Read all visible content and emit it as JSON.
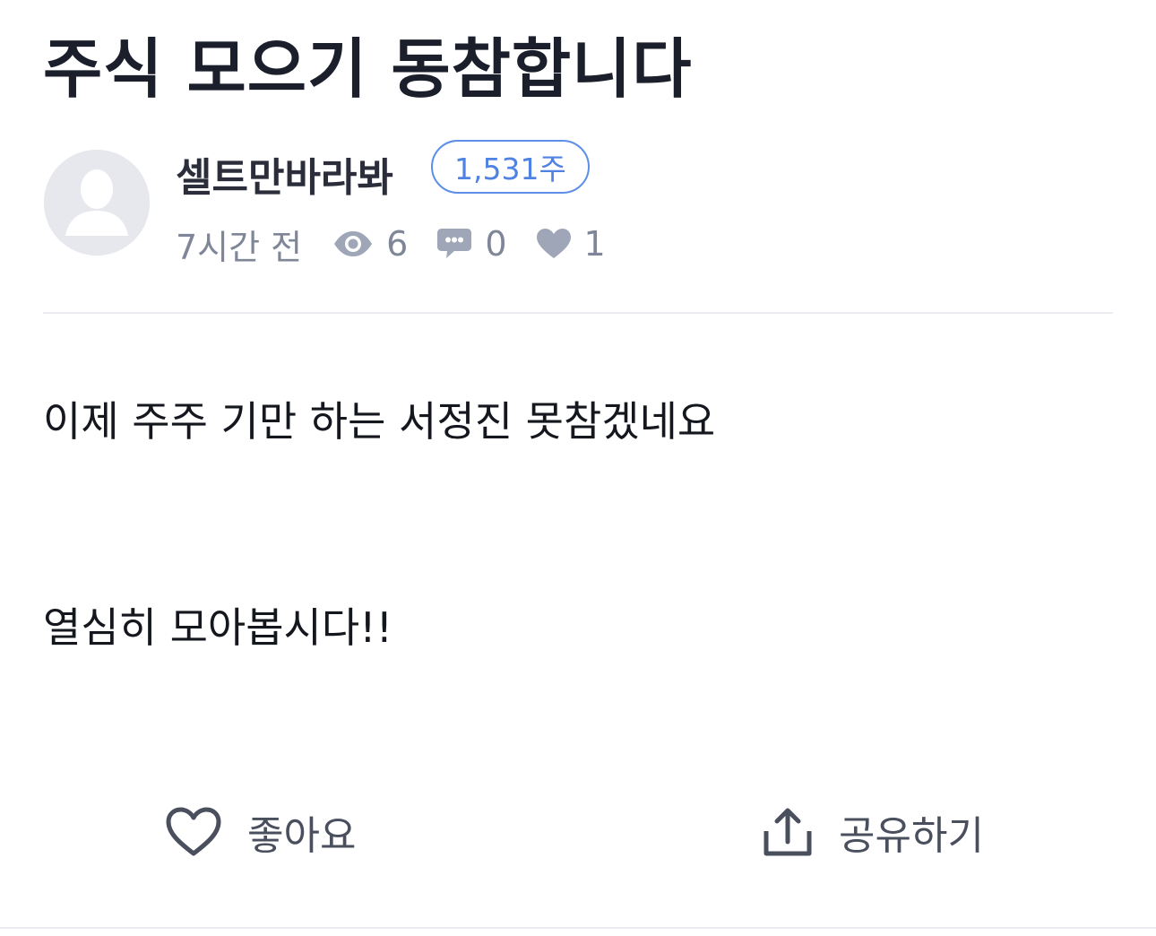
{
  "post": {
    "title": "주식 모으기 동참합니다",
    "author": {
      "name": "셀트만바라봐",
      "shares_badge": "1,531주",
      "avatar_icon": "user-silhouette-icon"
    },
    "meta": {
      "time_ago": "7시간 전",
      "views": "6",
      "comments": "0",
      "likes": "1"
    },
    "body": [
      "이제 주주 기만 하는 서정진 못참겠네요",
      "열심히 모아봅시다!!"
    ]
  },
  "actions": {
    "like_label": "좋아요",
    "share_label": "공유하기"
  },
  "colors": {
    "badge_accent": "#4f82e3",
    "meta_gray": "#7f8698",
    "icon_gray": "#9ea6b8",
    "title_dark": "#1b1e2b"
  }
}
